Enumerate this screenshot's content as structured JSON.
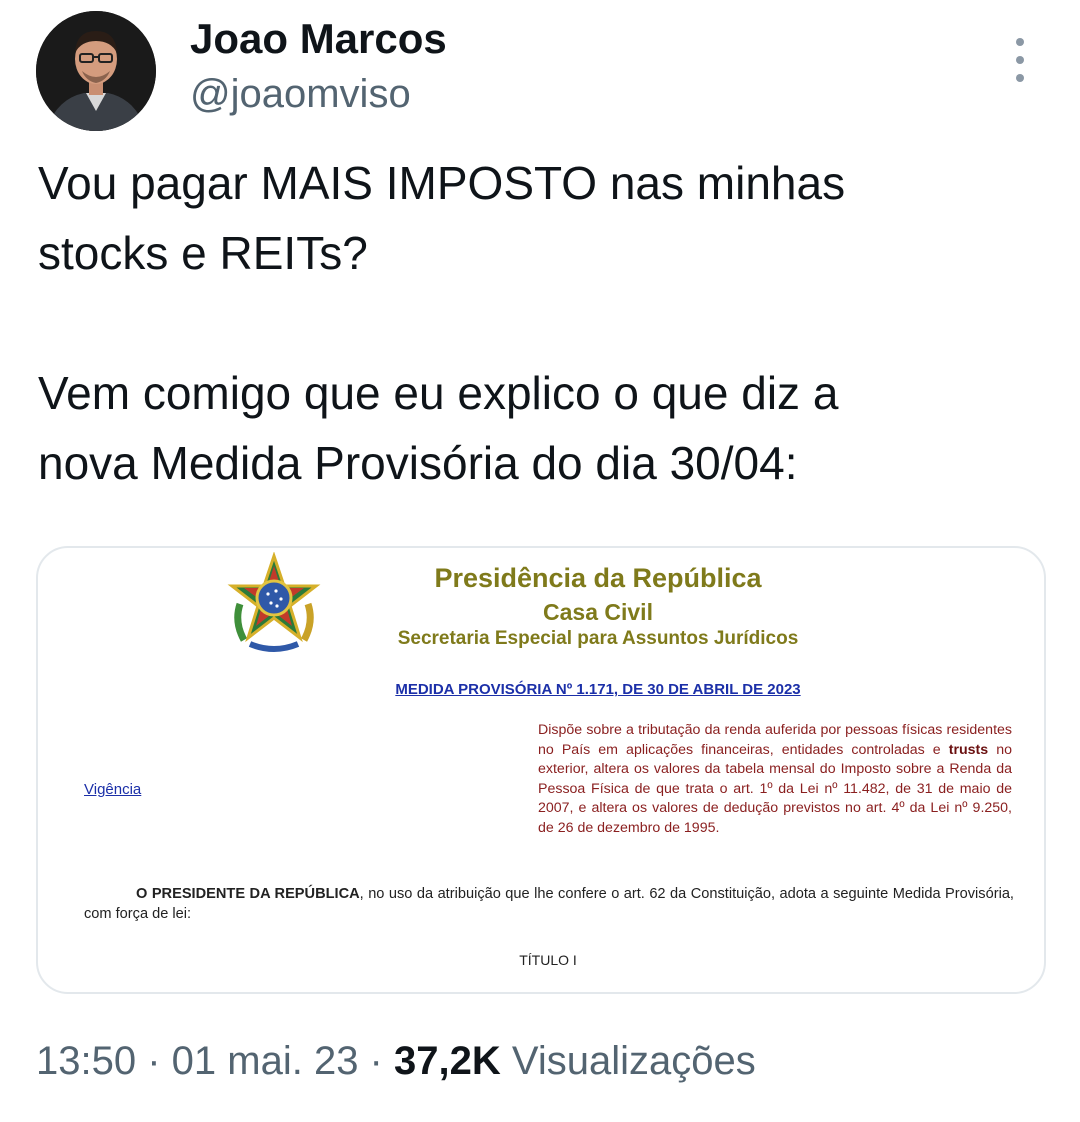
{
  "author": {
    "name": "Joao Marcos",
    "handle": "@joaomviso"
  },
  "tweet": {
    "text": "Vou pagar MAIS IMPOSTO nas minhas\nstocks e REITs?\n\nVem comigo que eu explico o que diz a\nnova Medida Provisória do dia 30/04:"
  },
  "document": {
    "title": "Presidência da República",
    "subtitle": "Casa Civil",
    "secretariat": "Secretaria Especial para Assuntos Jurídicos",
    "mp_title": "MEDIDA PROVISÓRIA Nº 1.171, DE 30 DE ABRIL DE 2023",
    "vigencia": "Vigência",
    "ementa_part1": "Dispõe sobre a tributação da renda auferida por pessoas físicas residentes no País em aplicações financeiras, entidades controladas e ",
    "ementa_bold": "trusts",
    "ementa_part2": " no exterior, altera os valores da tabela mensal do Imposto sobre a Renda da Pessoa Física de que trata o art. 1º da Lei nº 11.482, de 31 de maio de 2007, e altera os valores de dedução previstos no art. 4º da Lei nº 9.250, de 26 de dezembro de 1995.",
    "presidente_bold": "O PRESIDENTE DA REPÚBLICA",
    "presidente_text": ", no uso da atribuição que lhe confere o art. 62 da Constituição, adota a seguinte Medida Provisória, com força de lei:",
    "titulo": "TÍTULO I"
  },
  "meta": {
    "time": "13:50",
    "separator": " · ",
    "date": "01 mai. 23",
    "views_count": "37,2K",
    "views_label": "Visualizações"
  },
  "icons": {
    "more": "more-vertical-icon",
    "seal": "brazil-coat-of-arms-icon"
  },
  "colors": {
    "text_primary": "#0f1419",
    "text_secondary": "#536471",
    "doc_title": "#7f7a1b",
    "doc_link": "#1b2fa8",
    "doc_ementa": "#8a1f1f"
  }
}
